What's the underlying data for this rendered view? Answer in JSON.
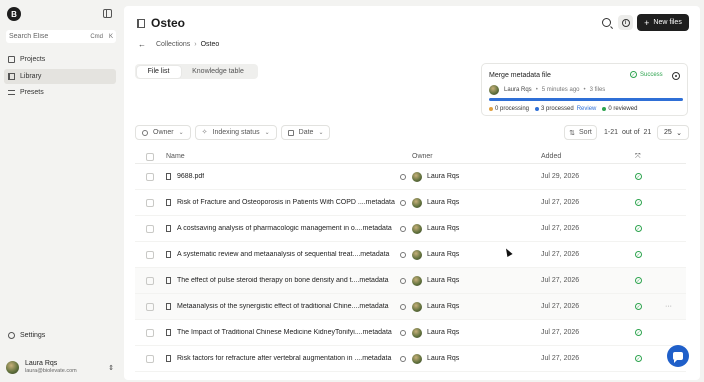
{
  "app": {
    "logo_letter": "B"
  },
  "sidebar": {
    "search": {
      "placeholder": "Search Elise",
      "shortcut_mod": "Cmd",
      "shortcut_key": "K"
    },
    "items": [
      {
        "label": "Projects",
        "icon": "projects-icon"
      },
      {
        "label": "Library",
        "icon": "library-icon",
        "active": true
      },
      {
        "label": "Presets",
        "icon": "presets-icon"
      }
    ],
    "settings_label": "Settings",
    "user": {
      "name": "Laura Rqs",
      "email": "laura@biolevate.com"
    }
  },
  "header": {
    "title": "Osteo",
    "new_button": "New files",
    "breadcrumb": {
      "parent": "Collections",
      "separator": "›",
      "current": "Osteo"
    }
  },
  "tabs": [
    {
      "label": "File list",
      "active": true
    },
    {
      "label": "Knowledge table"
    }
  ],
  "merge_card": {
    "title": "Merge metadata file",
    "status": "Success",
    "user": "Laura Rqs",
    "time": "5 minutes ago",
    "files": "3 files",
    "progress": 1.0,
    "progress_color": "#2f6fd6",
    "legend": {
      "processing": "0 processing",
      "processed": "3 processed",
      "review_link": "Review",
      "reviewed": "0 reviewed"
    },
    "legend_colors": {
      "processing": "#e0a040",
      "processed": "#2f6fd6",
      "reviewed": "#2ea44f"
    }
  },
  "filters": [
    {
      "label": "Owner",
      "icon": "person-icon"
    },
    {
      "label": "Indexing status",
      "icon": "sparkle-icon"
    },
    {
      "label": "Date",
      "icon": "calendar-icon"
    }
  ],
  "toolbar": {
    "sort": "Sort",
    "range": "1-21",
    "out_of": "out of",
    "total": "21",
    "per_page": "25"
  },
  "table": {
    "columns": {
      "name": "Name",
      "owner": "Owner",
      "added": "Added"
    },
    "rows": [
      {
        "name": "9688.pdf",
        "suffix": "",
        "owner": "Laura Rqs",
        "added": "Jul 29, 2026"
      },
      {
        "name": "Risk of Fracture and Osteoporosis in Patients With COPD ...",
        "suffix": ".metadata",
        "owner": "Laura Rqs",
        "added": "Jul 27, 2026"
      },
      {
        "name": "A costsaving analysis of pharmacologic management in o...",
        "suffix": ".metadata",
        "owner": "Laura Rqs",
        "added": "Jul 27, 2026"
      },
      {
        "name": "A systematic review and metaanalysis of sequential treat...",
        "suffix": ".metadata",
        "owner": "Laura Rqs",
        "added": "Jul 27, 2026"
      },
      {
        "name": "The effect of pulse steroid therapy on bone density and t...",
        "suffix": ".metadata",
        "owner": "Laura Rqs",
        "added": "Jul 27, 2026"
      },
      {
        "name": "Metaanalysis of the synergistic effect of traditional Chine...",
        "suffix": ".metadata",
        "owner": "Laura Rqs",
        "added": "Jul 27, 2026",
        "more": "···"
      },
      {
        "name": "The Impact of Traditional Chinese Medicine KidneyTonifyi...",
        "suffix": ".metadata",
        "owner": "Laura Rqs",
        "added": "Jul 27, 2026"
      },
      {
        "name": "Risk factors for refracture after vertebral augmentation in ...",
        "suffix": ".metadata",
        "owner": "Laura Rqs",
        "added": "Jul 27, 2026"
      }
    ]
  }
}
